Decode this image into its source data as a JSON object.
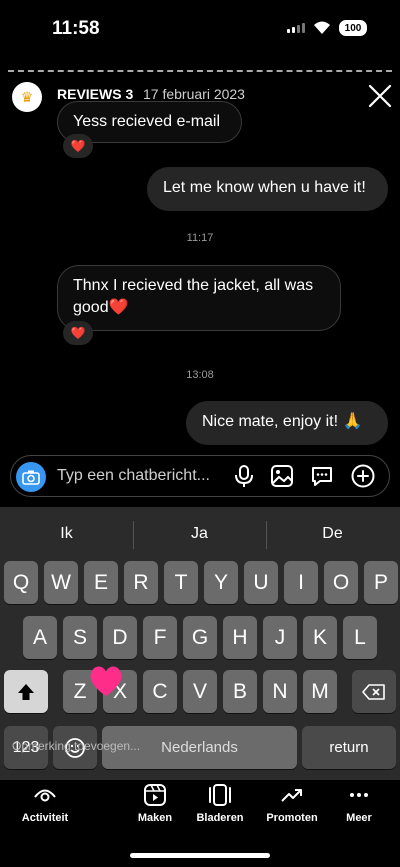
{
  "status": {
    "time": "11:58",
    "battery": "100"
  },
  "header": {
    "name": "REVIEWS 3",
    "date": "17 februari 2023"
  },
  "messages": [
    {
      "text": "Yess recieved e-mail",
      "reaction": "❤️"
    },
    {
      "text": "Let me know when u have it!"
    },
    {
      "timestamp": "11:17"
    },
    {
      "text": "Thnx I recieved the jacket, all was good❤️",
      "reaction": "❤️"
    },
    {
      "timestamp": "13:08"
    },
    {
      "text": "Nice mate, enjoy it! 🙏"
    }
  ],
  "composer": {
    "placeholder": "Typ een chatbericht..."
  },
  "keyboard": {
    "suggestions": [
      "Ik",
      "Ja",
      "De"
    ],
    "row1": [
      "Q",
      "W",
      "E",
      "R",
      "T",
      "Y",
      "U",
      "I",
      "O",
      "P"
    ],
    "row2": [
      "A",
      "S",
      "D",
      "F",
      "G",
      "H",
      "J",
      "K",
      "L"
    ],
    "row3": [
      "Z",
      "X",
      "C",
      "V",
      "B",
      "N",
      "M"
    ],
    "numbers_key": "123",
    "space_key": "Nederlands",
    "return_key": "return",
    "overlay_text": "Opmerking toevoegen..."
  },
  "nav": {
    "items": [
      "Activiteit",
      "Maken",
      "Bladeren",
      "Promoten",
      "Meer"
    ]
  },
  "colors": {
    "accent": "#3797f0",
    "heart": "#ff2d55"
  }
}
